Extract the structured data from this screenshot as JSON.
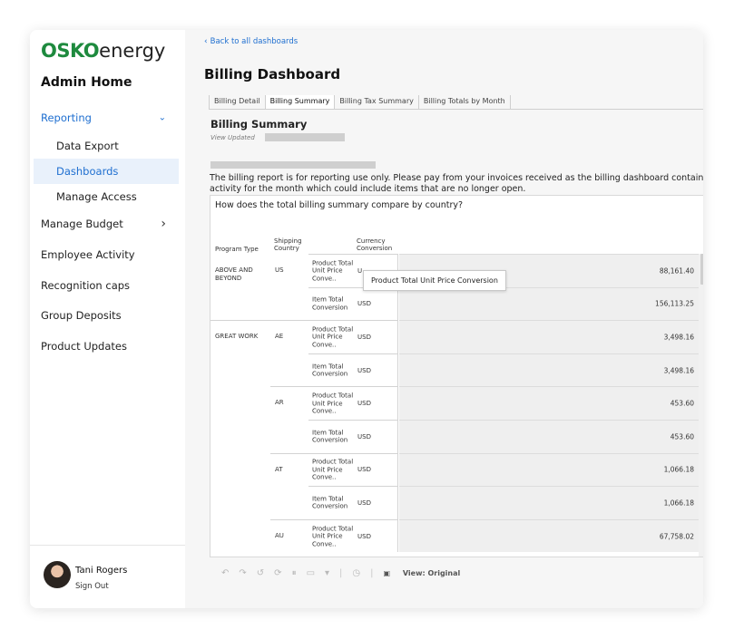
{
  "logo": {
    "brand": "OSKO",
    "suffix": "energy"
  },
  "sidebar": {
    "title": "Admin Home",
    "items": [
      {
        "label": "Reporting",
        "chevron": "⌄",
        "state": "expanded"
      },
      {
        "label": "Data Export"
      },
      {
        "label": "Dashboards",
        "state": "selected"
      },
      {
        "label": "Manage Access"
      },
      {
        "label": "Manage Budget",
        "chevron": "›"
      },
      {
        "label": "Employee Activity"
      },
      {
        "label": "Recognition caps"
      },
      {
        "label": "Group Deposits"
      },
      {
        "label": "Product Updates"
      }
    ],
    "user": {
      "name": "Tani Rogers",
      "sign_out": "Sign Out"
    }
  },
  "main": {
    "back_label": "Back to all dashboards",
    "title": "Billing Dashboard",
    "tabs": [
      "Billing Detail",
      "Billing Summary",
      "Billing Tax Summary",
      "Billing Totals by Month"
    ],
    "active_tab": "Billing Summary",
    "summary_title": "Billing Summary",
    "view_updated": "View Updated",
    "notice": "The billing report is for reporting use only. Please pay from your invoices received as the billing dashboard contains activity for the month which could include items that are no longer open.",
    "question": "How does the total billing summary compare by country?",
    "headers": {
      "program_type": "Program Type",
      "shipping_country": "Shipping Country",
      "currency_conversion": "Currency Conversion"
    },
    "rows": [
      {
        "program": "ABOVE AND BEYOND",
        "country": "US",
        "measure": "Product Total Unit Price Conve..",
        "currency": "U",
        "value": "88,161.40"
      },
      {
        "program": "",
        "country": "",
        "measure": "Item Total Conversion",
        "currency": "USD",
        "value": "156,113.25"
      },
      {
        "program": "GREAT WORK",
        "country": "AE",
        "measure": "Product Total Unit Price Conve..",
        "currency": "USD",
        "value": "3,498.16"
      },
      {
        "program": "",
        "country": "",
        "measure": "Item Total Conversion",
        "currency": "USD",
        "value": "3,498.16"
      },
      {
        "program": "",
        "country": "AR",
        "measure": "Product Total Unit Price Conve..",
        "currency": "USD",
        "value": "453.60"
      },
      {
        "program": "",
        "country": "",
        "measure": "Item Total Conversion",
        "currency": "USD",
        "value": "453.60"
      },
      {
        "program": "",
        "country": "AT",
        "measure": "Product Total Unit Price Conve..",
        "currency": "USD",
        "value": "1,066.18"
      },
      {
        "program": "",
        "country": "",
        "measure": "Item Total Conversion",
        "currency": "USD",
        "value": "1,066.18"
      },
      {
        "program": "",
        "country": "AU",
        "measure": "Product Total Unit Price Conve..",
        "currency": "USD",
        "value": "67,758.02"
      }
    ],
    "tooltip": "Product Total Unit Price Conversion",
    "toolbar": {
      "undo": "↶",
      "redo": "↷",
      "revert": "↺",
      "refresh": "⟳",
      "pause": "⏸",
      "comment": "▭",
      "dropdown": "▾",
      "sep": "|",
      "metrics": "◷",
      "view_label": "View: Original"
    }
  }
}
